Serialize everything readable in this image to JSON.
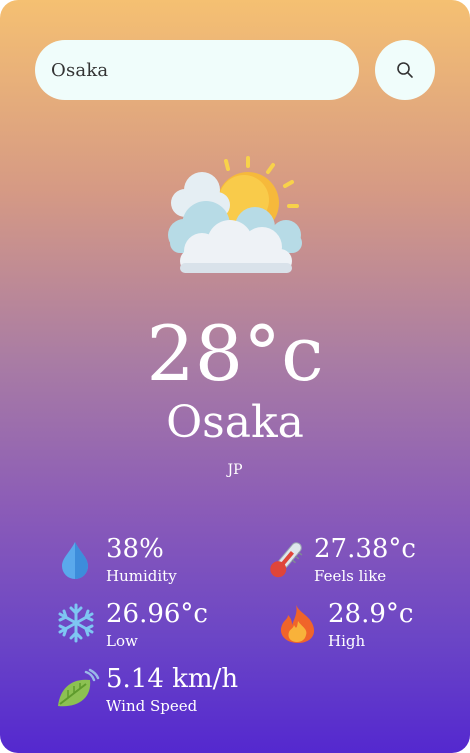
{
  "search": {
    "value": "Osaka"
  },
  "current": {
    "temperature": "28°c",
    "city": "Osaka",
    "country": "JP"
  },
  "stats": {
    "humidity": {
      "value": "38%",
      "label": "Humidity"
    },
    "feels_like": {
      "value": "27.38°c",
      "label": "Feels like"
    },
    "low": {
      "value": "26.96°c",
      "label": "Low"
    },
    "high": {
      "value": "28.9°c",
      "label": "High"
    },
    "wind": {
      "value": "5.14 km/h",
      "label": "Wind Speed"
    }
  },
  "icons": {
    "search": "search-icon",
    "weather": "partly-cloudy-icon",
    "humidity": "water-drop-icon",
    "feels_like": "thermometer-icon",
    "low": "snowflake-icon",
    "high": "fire-icon",
    "wind": "wind-leaf-icon"
  },
  "colors": {
    "gradient_top": "#f5c072",
    "gradient_bottom": "#5428cf",
    "input_bg": "#f0fdfb"
  }
}
